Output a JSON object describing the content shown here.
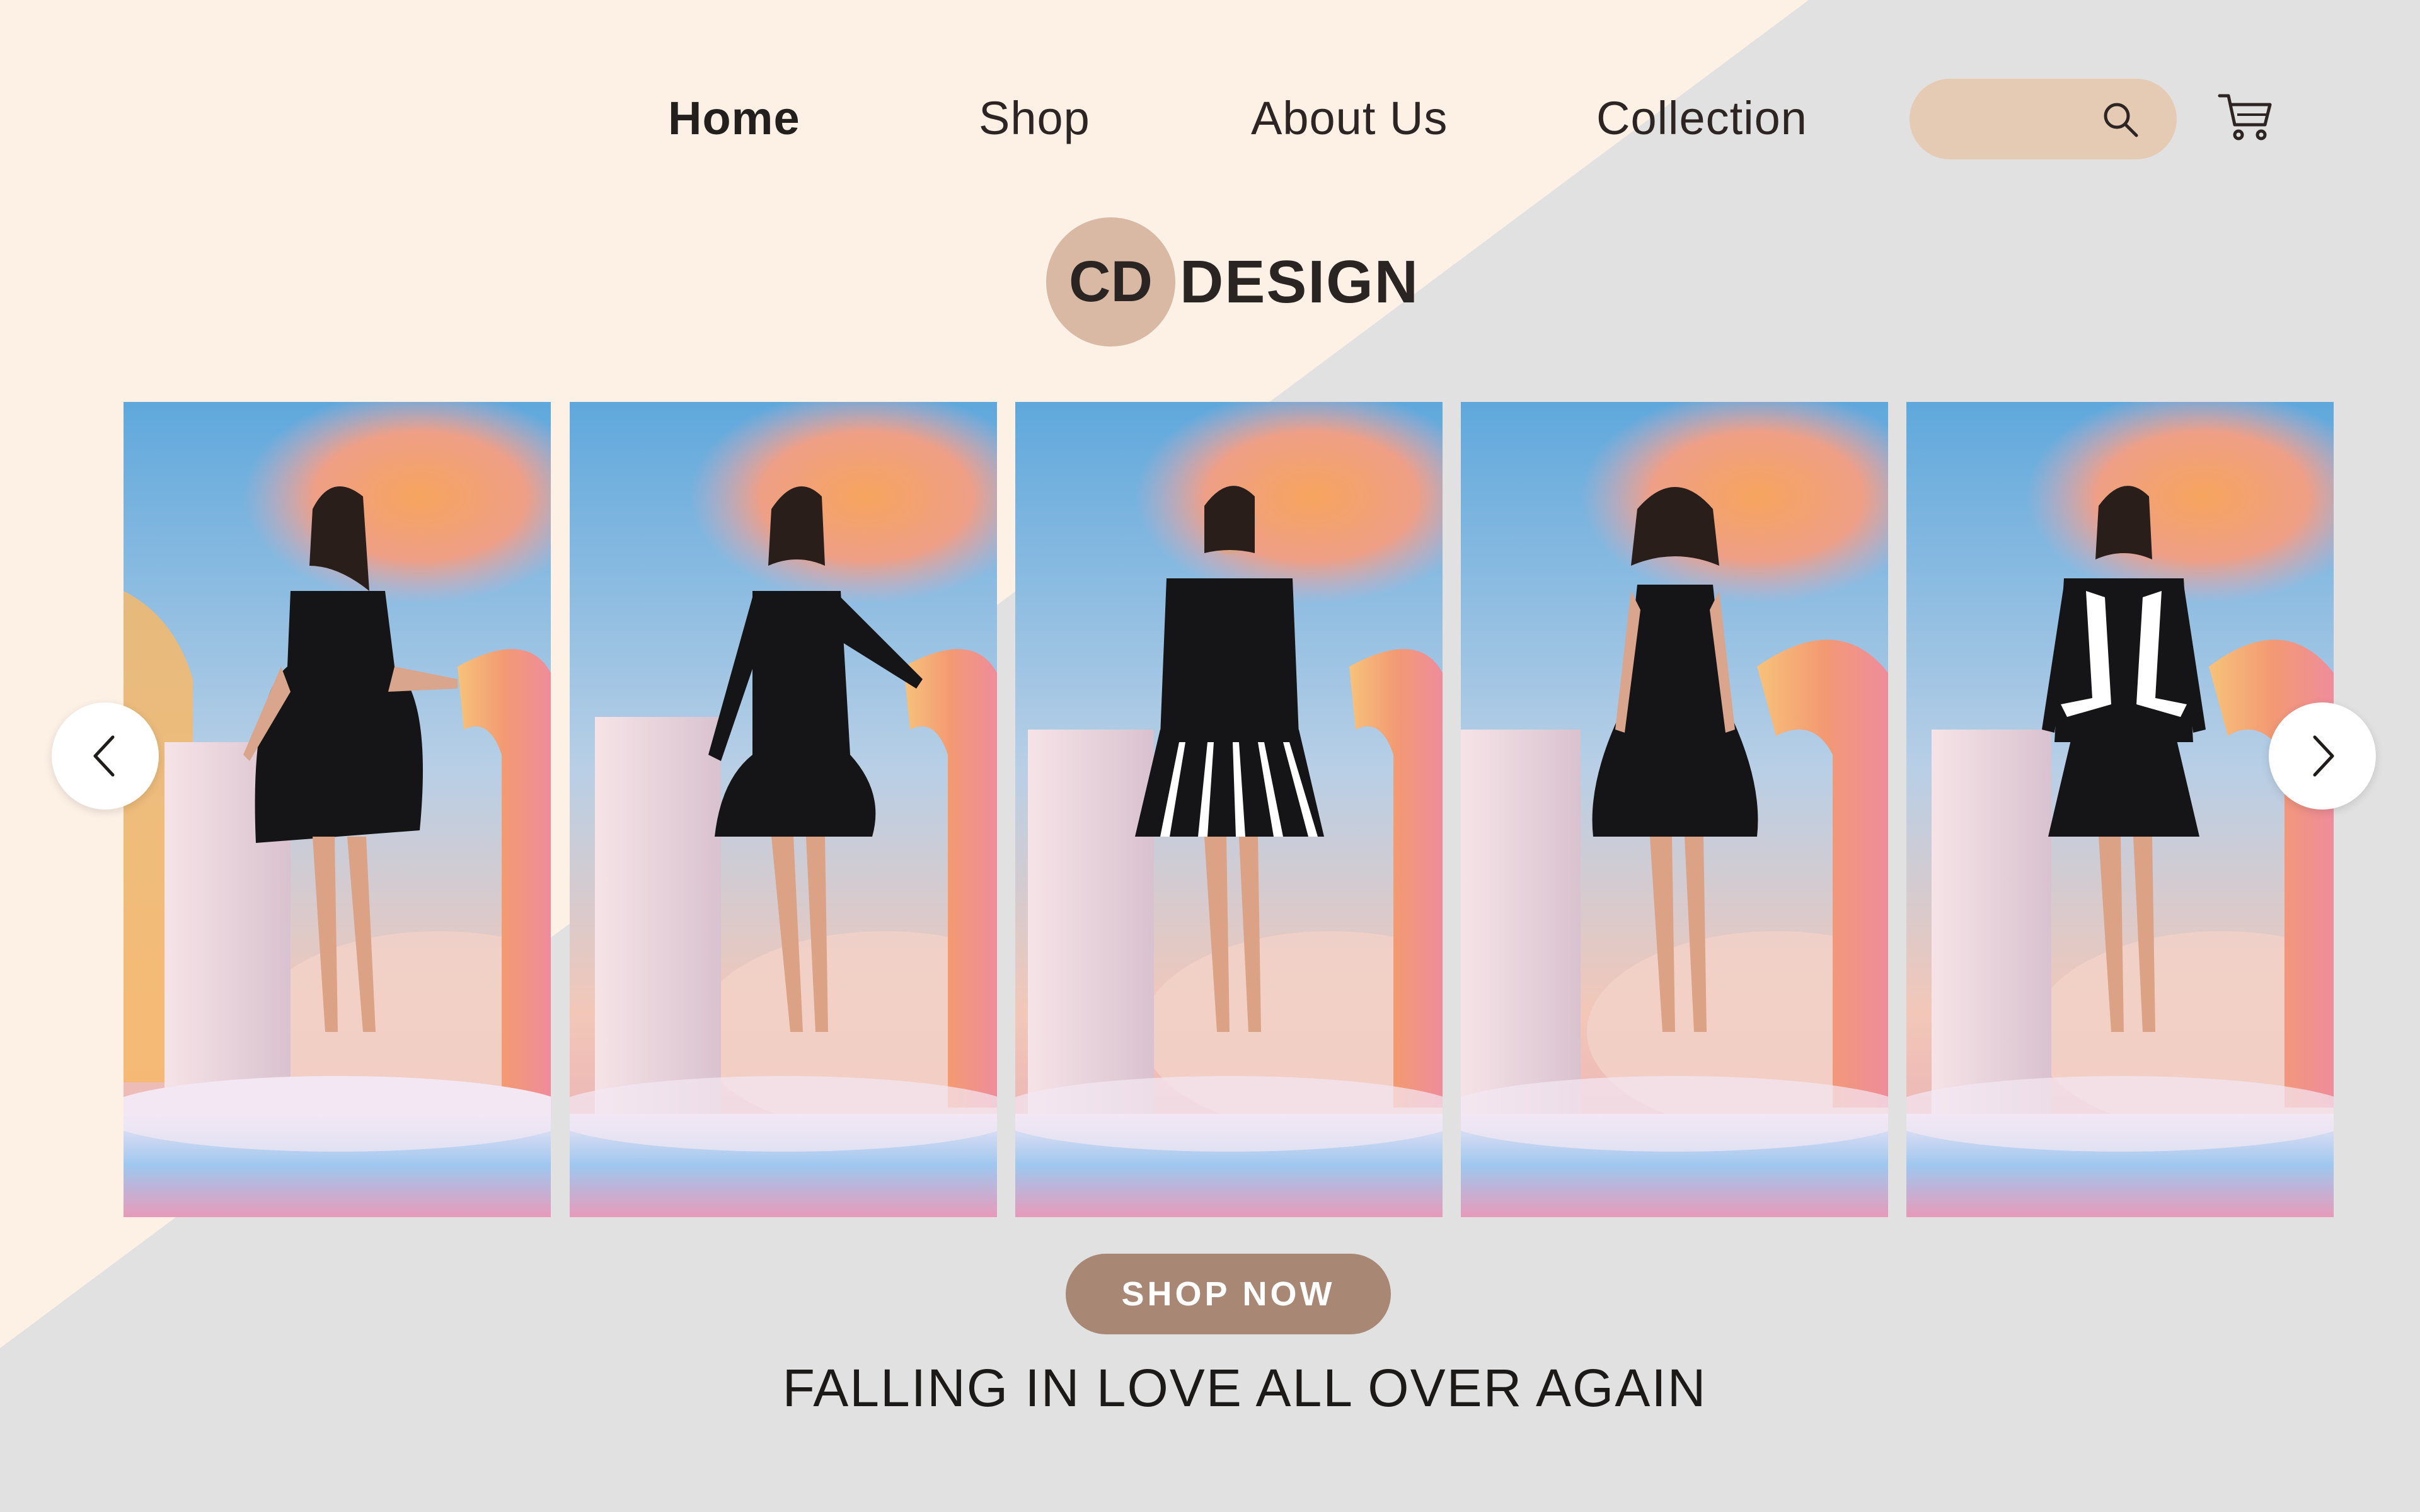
{
  "nav": {
    "items": [
      {
        "label": "Home",
        "active": true
      },
      {
        "label": "Shop",
        "active": false
      },
      {
        "label": "About Us",
        "active": false
      },
      {
        "label": "Collection",
        "active": false
      }
    ]
  },
  "search": {
    "placeholder": "",
    "icon": "search-icon"
  },
  "cart": {
    "icon": "cart-icon"
  },
  "logo": {
    "initials": "CD",
    "word": "DESIGN"
  },
  "carousel": {
    "prev_icon": "chevron-left-icon",
    "next_icon": "chevron-right-icon",
    "slides": [
      {
        "outfit": "black short-sleeve dress with bow"
      },
      {
        "outfit": "black long-sleeve mini dress"
      },
      {
        "outfit": "black blazer with striped pleated skirt"
      },
      {
        "outfit": "black sleeveless A-line dress"
      },
      {
        "outfit": "black cropped jacket over mini dress"
      }
    ]
  },
  "cta": {
    "label": "SHOP NOW"
  },
  "tagline": "FALLING IN LOVE ALL OVER AGAIN",
  "colors": {
    "background_light": "#fdf1e6",
    "background_gray": "#e1e1e1",
    "accent_tan": "#e6cbb4",
    "logo_circle": "#d9b9a3",
    "button_brown": "#a88875"
  }
}
